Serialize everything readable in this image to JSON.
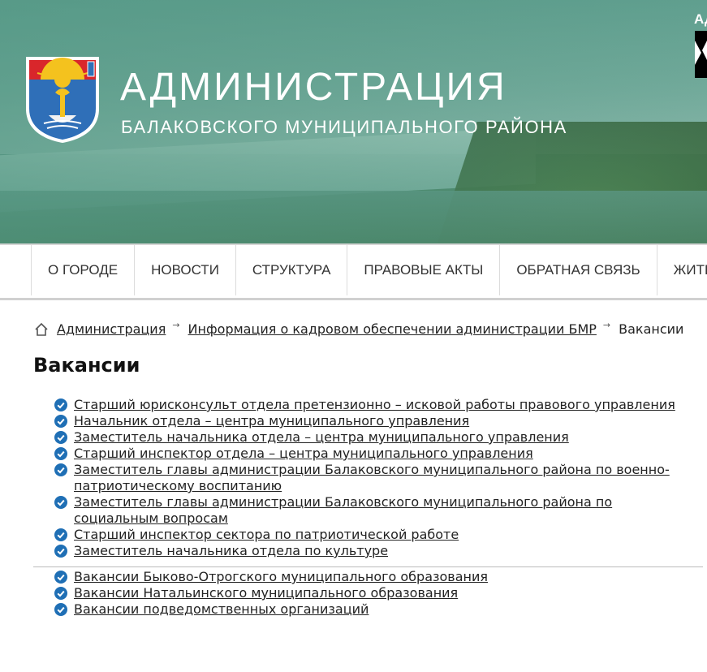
{
  "header": {
    "title": "АДМИНИСТРАЦИЯ",
    "subtitle": "БАЛАКОВСКОГО МУНИЦИПАЛЬНОГО РАЙОНА",
    "corner_text": "АД"
  },
  "nav": {
    "items": [
      "О ГОРОДЕ",
      "НОВОСТИ",
      "СТРУКТУРА",
      "ПРАВОВЫЕ АКТЫ",
      "ОБРАТНАЯ СВЯЗЬ",
      "ЖИТЕЛЯМ"
    ]
  },
  "breadcrumbs": {
    "items": [
      "Администрация",
      "Информация о кадровом обеспечении администрации БМР",
      "Вакансии"
    ],
    "separator": "→"
  },
  "page_title": "Вакансии",
  "vacancies": [
    "Старший юрисконсульт отдела претензионно – исковой работы правового  управления",
    "Начальник отдела – центра муниципального управления",
    "Заместитель начальника отдела – центра муниципального управления",
    "Старший инспектор отдела – центра муниципального управления",
    "Заместитель главы администрации Балаковского муниципального района по военно-патриотическому воспитанию",
    "Заместитель главы администрации Балаковского муниципального района по социальным вопросам",
    "Старший инспектор сектора по патриотической работе",
    "Заместитель начальника отдела по культуре"
  ],
  "other_vacancies": [
    "Вакансии Быково-Отрогского муниципального образования",
    "Вакансии Натальинского муниципального образования",
    "Вакансии подведомственных организаций"
  ],
  "colors": {
    "accent": "#1f6fb5",
    "header_bg": "#5e9c8c",
    "text": "#222222"
  },
  "icons": {
    "home": "home-icon",
    "check": "check-circle-icon"
  }
}
